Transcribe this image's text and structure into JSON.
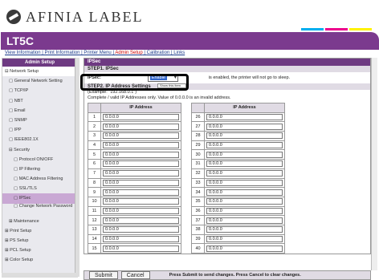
{
  "brand": {
    "logo_text": "AFINIA LABEL"
  },
  "header": {
    "title": "LT5C"
  },
  "topnav": {
    "links": [
      "View Information",
      "Print Information",
      "Printer Menu",
      "Admin Setup",
      "Calibration",
      "Links"
    ]
  },
  "sidebar": {
    "title": "Admin Setup",
    "items": [
      "⊟ Network Setup",
      "▢ General Network Setting",
      "▢ TCP/IP",
      "▢ NBT",
      "▢ Email",
      "▢ SNMP",
      "▢ IPP",
      "▢ IEEE802.1X",
      "⊟ Security",
      "▢ Protocol ON/OFF",
      "▢ IP Filtering",
      "▢ MAC Address Filtering",
      "▢ SSL/TLS",
      "▢ IPSec",
      "▢ Change Network Password",
      "⊞ Maintenance",
      "⊞ Print Setup",
      "⊞ PS Setup",
      "⊞ PCL Setup",
      "⊞ Color Setup"
    ]
  },
  "panel": {
    "title": "IPSec",
    "step1": "STEP1. IPSec",
    "ipsec_label": "IPSec:",
    "ipsec_value": "Enable",
    "ipsec_option": "Show this item",
    "ipsec_note": "is enabled, the printer will not go to sleep.",
    "step2": "STEP2. IP Address Settings",
    "example": "(Example: \"192.168.0.1\")",
    "note": "Complete / valid IP Addresses only. Value of 0.0.0.0 is an invalid address.",
    "col_header": "IP Address",
    "default_ip": "0.0.0.0",
    "left_rows": [
      "1",
      "2",
      "3",
      "4",
      "5",
      "6",
      "7",
      "8",
      "9",
      "10",
      "11",
      "12",
      "13",
      "14",
      "15"
    ],
    "right_rows": [
      "26",
      "27",
      "28",
      "29",
      "30",
      "31",
      "32",
      "33",
      "34",
      "35",
      "36",
      "37",
      "38",
      "39",
      "40"
    ]
  },
  "footer": {
    "submit": "Submit",
    "cancel": "Cancel",
    "hint": "Press Submit to send changes. Press Cancel to clear changes."
  },
  "colors": {
    "brand_purple": "#7b3a8e",
    "cyan": "#00aeef",
    "magenta": "#ec008c",
    "yellow": "#fff200",
    "black": "#231f20"
  }
}
